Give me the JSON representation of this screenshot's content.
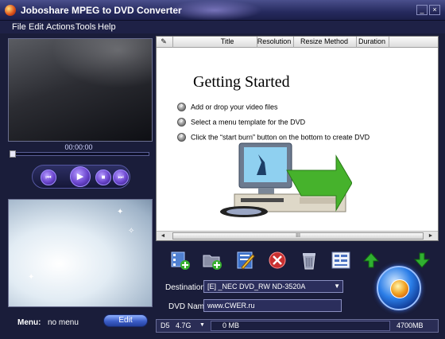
{
  "window": {
    "title": "Joboshare MPEG to DVD Converter",
    "minimize_glyph": "_",
    "close_glyph": "×"
  },
  "menubar": [
    "File",
    "Edit",
    "Actions",
    "Tools",
    "Help"
  ],
  "player": {
    "time": "00:00:00",
    "seek_position": 0,
    "buttons": [
      "previous-icon",
      "play-icon",
      "stop-icon",
      "next-icon"
    ]
  },
  "menu_panel": {
    "label": "Menu:",
    "value": "no menu",
    "edit_label": "Edit"
  },
  "file_list": {
    "columns": [
      "Title",
      "Resolution",
      "Resize Method",
      "Duration"
    ],
    "rows": []
  },
  "getting_started": {
    "title": "Getting Started",
    "steps": [
      "Add or drop your video files",
      "Select a menu template for the DVD",
      "Click the “start burn” button on the bottom to create DVD"
    ]
  },
  "scrollbar": {
    "left_arrow": "◄",
    "right_arrow": "►",
    "grip": "III"
  },
  "toolbar": [
    "add-video-icon",
    "add-folder-icon",
    "edit-icon",
    "remove-icon",
    "clear-icon",
    "settings-icon",
    "move-up-icon",
    "move-down-icon"
  ],
  "destination": {
    "label": "Destination:",
    "value": "[E] _NEC DVD_RW ND-3520A",
    "caret": "▼"
  },
  "dvd_name": {
    "label": "DVD Name:",
    "value": "www.CWER.ru"
  },
  "status": {
    "disc_type": "D5",
    "disc_size": "4.7G",
    "size_caret": "▼",
    "used": "0 MB",
    "capacity": "4700MB",
    "progress_fraction": 0
  },
  "colors": {
    "frame": "#1a1d3a",
    "accent": "#3c5ec8",
    "burn": "#2b7ee8"
  }
}
